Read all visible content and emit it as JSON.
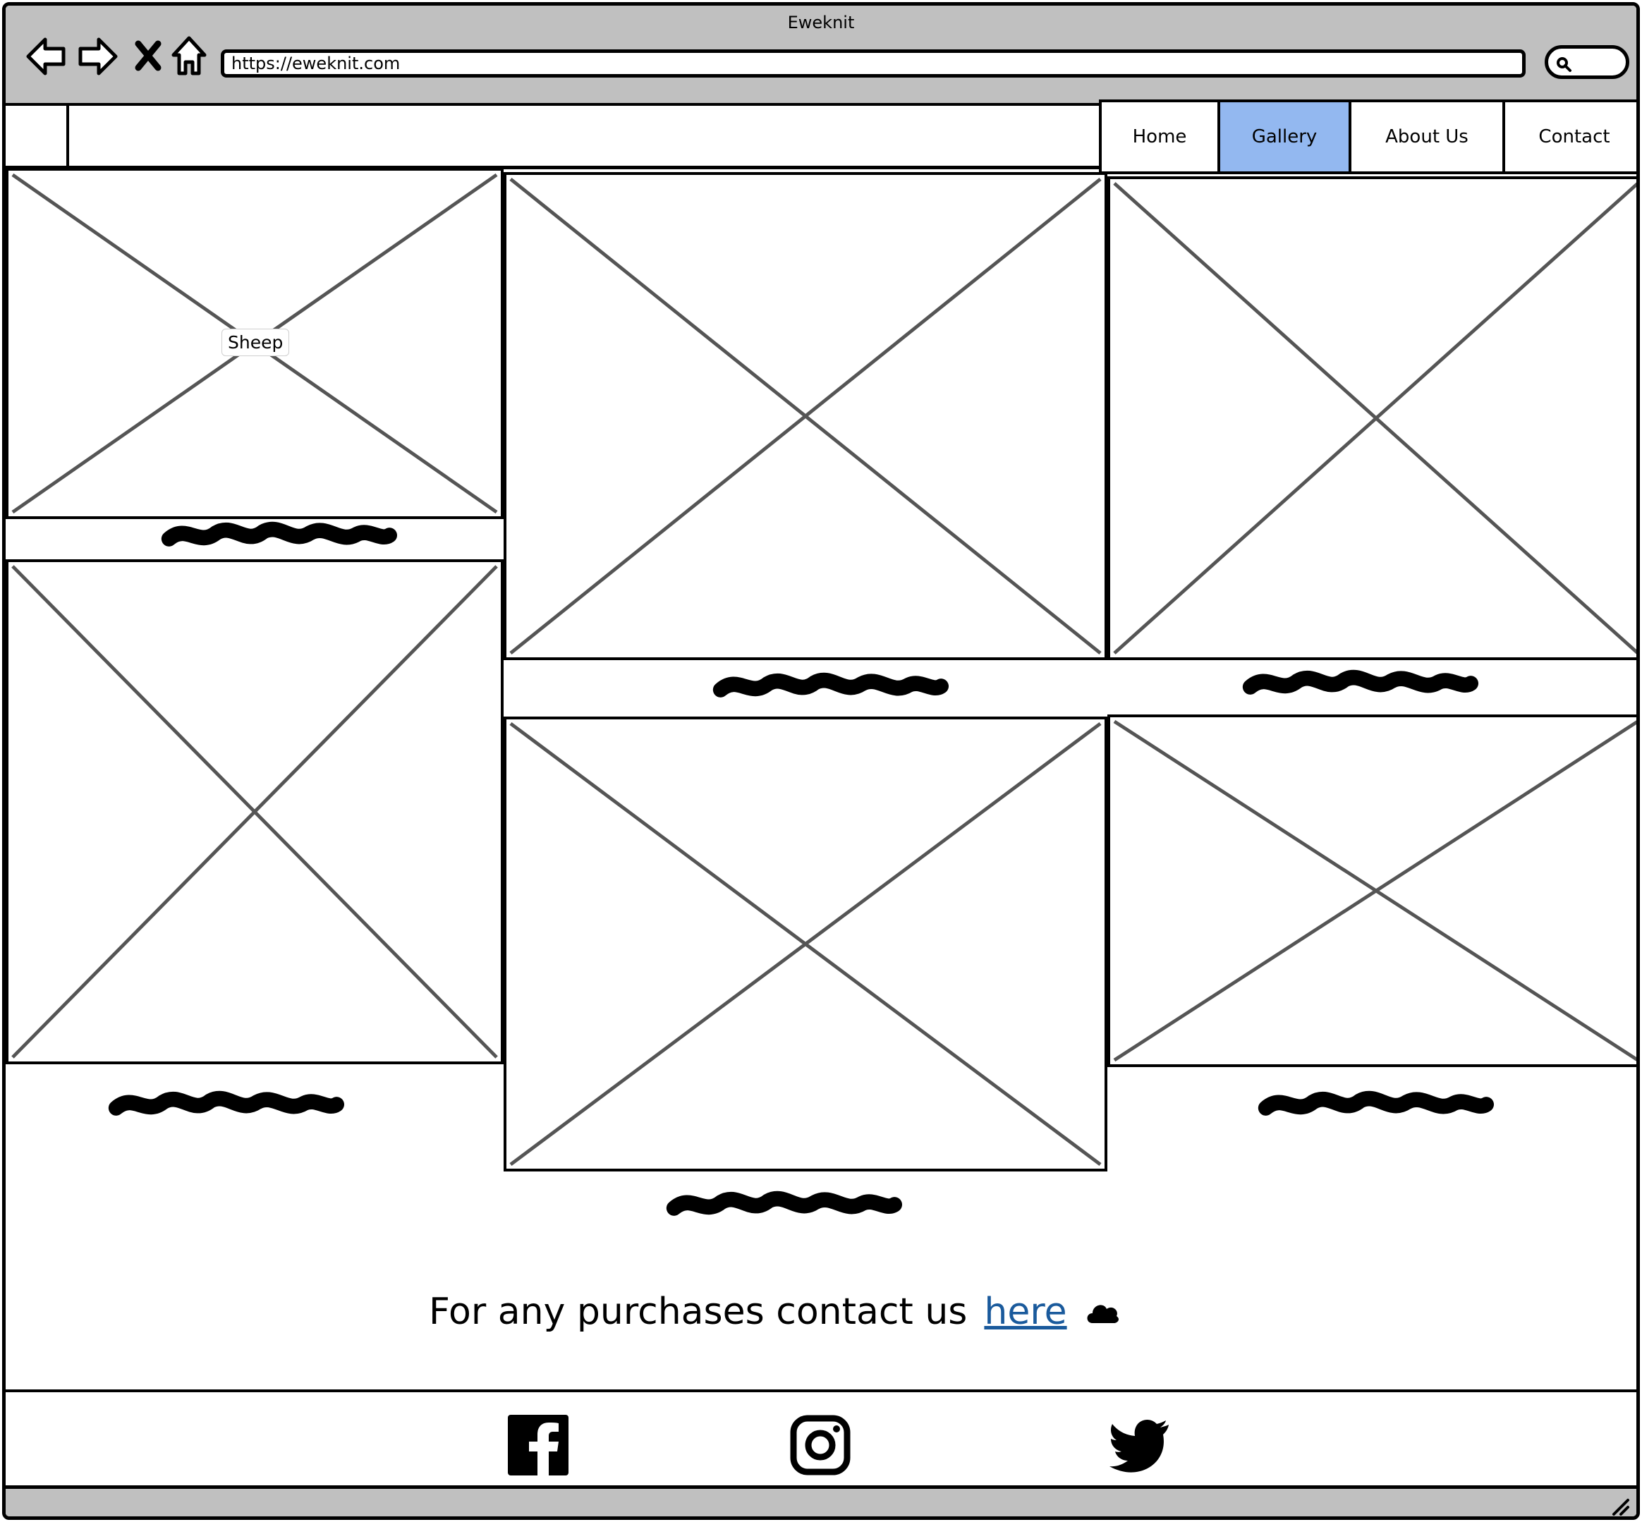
{
  "window": {
    "title": "Eweknit"
  },
  "browser": {
    "url": "https://eweknit.com",
    "back_icon": "back-arrow-icon",
    "forward_icon": "forward-arrow-icon",
    "stop_icon": "close-icon",
    "home_icon": "home-icon",
    "search_icon": "search-icon"
  },
  "nav": {
    "items": [
      {
        "label": "Home",
        "active": false
      },
      {
        "label": "Gallery",
        "active": true
      },
      {
        "label": "About Us",
        "active": false
      },
      {
        "label": "Contact",
        "active": false
      }
    ],
    "active_color": "#93b8f0"
  },
  "gallery": {
    "tooltip": "Sheep"
  },
  "contact": {
    "text": "For any purchases contact us",
    "link_label": "here",
    "icon": "cloud-icon"
  },
  "footer": {
    "icons": [
      "facebook-icon",
      "instagram-icon",
      "twitter-icon"
    ]
  },
  "colors": {
    "chrome": "#c0c0c0",
    "link": "#1a5a9c"
  }
}
